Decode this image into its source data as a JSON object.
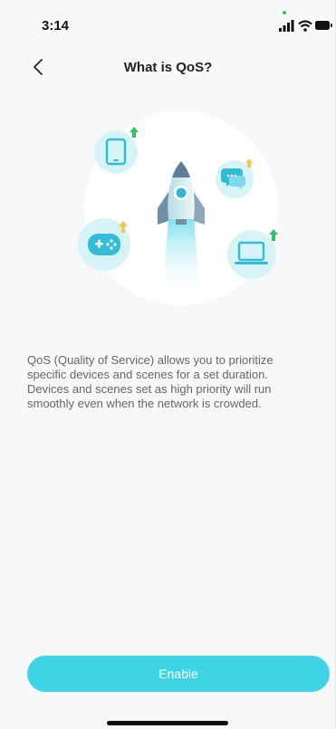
{
  "status_bar": {
    "time": "3:14",
    "icons": [
      "signal-icon",
      "wifi-icon",
      "battery-icon"
    ],
    "dot_color": "#34c759"
  },
  "nav": {
    "back_icon": "chevron-left-icon",
    "title": "What is QoS?"
  },
  "illustration": {
    "items": [
      "rocket-icon",
      "tablet-icon",
      "chat-icon",
      "gamepad-icon",
      "laptop-icon"
    ],
    "colors": {
      "circle": "#ffffff",
      "device_bg": "#d6f3f7",
      "device": "#33bcd6",
      "arrow_green": "#2fc463",
      "arrow_yellow": "#f2c94c",
      "rocket_body": "#cfe8f0",
      "rocket_dark": "#6f8fa3"
    }
  },
  "content": {
    "description": "QoS (Quality of Service) allows you to prioritize specific devices and scenes for a set duration. Devices and scenes set as high priority will run smoothly even when the network is crowded."
  },
  "actions": {
    "enable_label": "Enable",
    "accent_color": "#3fd3e6"
  }
}
